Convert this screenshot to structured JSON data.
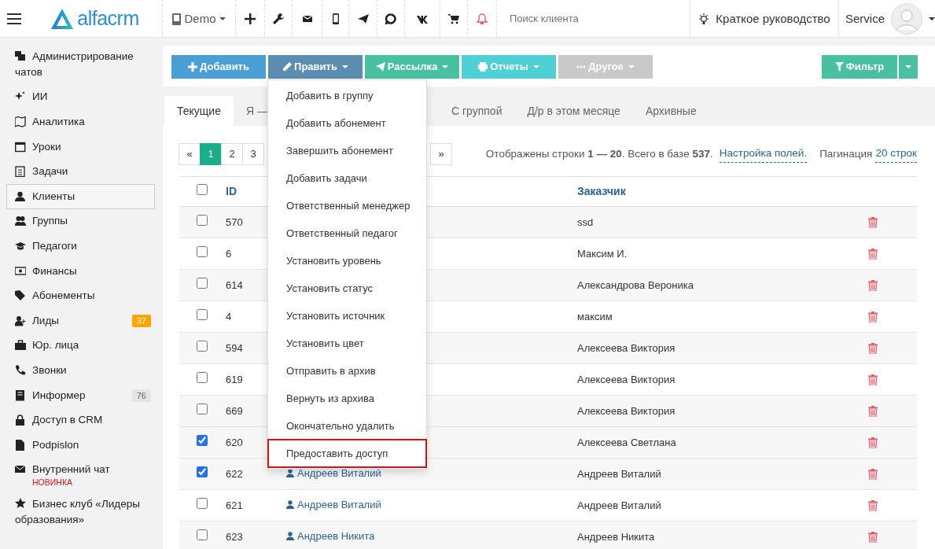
{
  "header": {
    "logo": "alfacrm",
    "branch": "Demo",
    "search": {
      "placeholder": "Поиск клиента"
    },
    "guide": "Краткое руководство",
    "user": "Service"
  },
  "sidebar": {
    "items": [
      {
        "label": "Администрирование чатов",
        "selected": false
      },
      {
        "label": "ИИ",
        "selected": false
      },
      {
        "label": "Аналитика",
        "selected": false
      },
      {
        "label": "Уроки",
        "selected": false
      },
      {
        "label": "Задачи",
        "selected": false
      },
      {
        "label": "Клиенты",
        "selected": true
      },
      {
        "label": "Группы",
        "selected": false
      },
      {
        "label": "Педагоги",
        "selected": false
      },
      {
        "label": "Финансы",
        "selected": false
      },
      {
        "label": "Абонементы",
        "selected": false
      },
      {
        "label": "Лиды",
        "selected": false,
        "badge": {
          "text": "37",
          "color": "#ffa500"
        }
      },
      {
        "label": "Юр. лица",
        "selected": false
      },
      {
        "label": "Звонки",
        "selected": false
      },
      {
        "label": "Информер",
        "selected": false,
        "badge": {
          "text": "76",
          "color": "#e4e4e4"
        }
      },
      {
        "label": "Доступ в CRM",
        "selected": false
      },
      {
        "label": "Podpislon",
        "selected": false
      },
      {
        "label": "Внутренний чат",
        "selected": false,
        "note": "НОВИНКА"
      },
      {
        "label": "Бизнес клуб «Лидеры образования»",
        "selected": false
      }
    ]
  },
  "toolbar": {
    "buttons": [
      {
        "label": "Добавить",
        "color": "#4a9fd5",
        "caret": false
      },
      {
        "label": "Править",
        "color": "#5b8db0",
        "caret": true
      },
      {
        "label": "Рассылка",
        "color": "#48c1a0",
        "caret": true
      },
      {
        "label": "Отчеты",
        "color": "#4fd0d5",
        "caret": true
      },
      {
        "label": "Другое",
        "color": "#c9c9c9",
        "caret": true
      }
    ],
    "filter": {
      "label": "Фильтр",
      "color": "#48c1a0"
    }
  },
  "tabs": [
    {
      "label": "Текущие",
      "selected": true,
      "cut": false
    },
    {
      "label": "Я —",
      "selected": false,
      "cut": true
    },
    {
      "label": "С группой",
      "selected": false,
      "cut": false
    },
    {
      "label": "Д/р в этом месяце",
      "selected": false,
      "cut": false
    },
    {
      "label": "Архивные",
      "selected": false,
      "cut": false
    }
  ],
  "pagination": [
    {
      "label": "«",
      "selected": false
    },
    {
      "label": "1",
      "selected": true
    },
    {
      "label": "2",
      "selected": false
    },
    {
      "label": "3",
      "selected": false
    },
    {
      "label": "»",
      "selected": false
    }
  ],
  "summary": {
    "text": "Отображены строки **1 — 20**. Всего в базе **537**.",
    "fields_link": "Настройка полей.",
    "pagination_label": "Пагинация",
    "pagination_link": "20 строк"
  },
  "table": {
    "all_checked": false,
    "columns": [
      "ID",
      "Заказчик"
    ],
    "rows": [
      {
        "id": "570",
        "customer": "ssd",
        "checked": false
      },
      {
        "id": "6",
        "customer": "Максим И.",
        "checked": false
      },
      {
        "id": "614",
        "customer": "Александрова Вероника",
        "checked": false
      },
      {
        "id": "4",
        "customer": "максим",
        "checked": false
      },
      {
        "id": "594",
        "customer": "Алексеева Виктория",
        "checked": false
      },
      {
        "id": "619",
        "customer": "Алексеева Виктория",
        "checked": false
      },
      {
        "id": "669",
        "customer": "Алексеева Виктория",
        "checked": false
      },
      {
        "id": "620",
        "customer": "Алексеева Светлана",
        "checked": true
      },
      {
        "id": "622",
        "name": "Андреев Виталий",
        "customer": "Андреев Виталий",
        "checked": true
      },
      {
        "id": "621",
        "name": "Андреев Виталий",
        "customer": "Андреев Виталий",
        "checked": false
      },
      {
        "id": "623",
        "name": "Андреев Никита",
        "customer": "Андреев Никита",
        "checked": false
      }
    ]
  },
  "edit_menu": {
    "items": [
      {
        "label": "Добавить в группу",
        "highlighted": false
      },
      {
        "label": "Добавить абонемент",
        "highlighted": false
      },
      {
        "label": "Завершить абонемент",
        "highlighted": false
      },
      {
        "label": "Добавить задачи",
        "highlighted": false
      },
      {
        "label": "Ответственный менеджер",
        "highlighted": false
      },
      {
        "label": "Ответственный педагог",
        "highlighted": false
      },
      {
        "label": "Установить уровень",
        "highlighted": false
      },
      {
        "label": "Установить статус",
        "highlighted": false
      },
      {
        "label": "Установить источник",
        "highlighted": false
      },
      {
        "label": "Установить цвет",
        "highlighted": false
      },
      {
        "label": "Отправить в архив",
        "highlighted": false
      },
      {
        "label": "Вернуть из архива",
        "highlighted": false
      },
      {
        "label": "Окончательно удалить",
        "highlighted": false
      },
      {
        "label": "Предоставить доступ",
        "highlighted": true
      }
    ]
  }
}
